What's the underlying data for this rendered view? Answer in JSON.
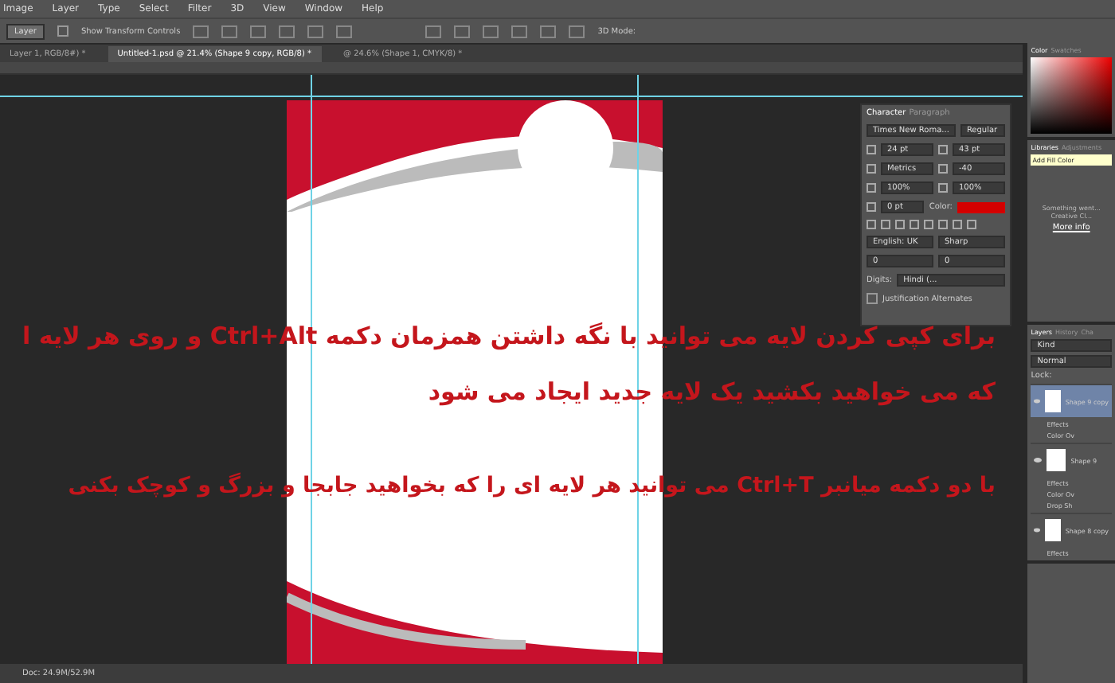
{
  "menu": [
    "Image",
    "Layer",
    "Type",
    "Select",
    "Filter",
    "3D",
    "View",
    "Window",
    "Help"
  ],
  "options_bar": {
    "select": "Layer",
    "show_transform_controls": {
      "label": "Show Transform Controls",
      "checked": false
    },
    "mode_label": "3D Mode:"
  },
  "tabs": [
    {
      "label": "Layer 1, RGB/8#) *",
      "selected": false
    },
    {
      "label": "Untitled-1.psd @ 21.4% (Shape 9 copy, RGB/8) *",
      "selected": true
    },
    {
      "label": "@ 24.6% (Shape 1, CMYK/8) *",
      "selected": false
    }
  ],
  "character_panel": {
    "tabs": [
      {
        "label": "Character",
        "selected": true
      },
      {
        "label": "Paragraph",
        "selected": false
      }
    ],
    "font": "Times New Roma...",
    "style": "Regular",
    "size": "24 pt",
    "leading": "43 pt",
    "kerning": "Metrics",
    "tracking": "-40",
    "vertical_scale": "100%",
    "horizontal_scale": "100%",
    "baseline": "0 pt",
    "color_label": "Color:",
    "color": "#d40000",
    "language": "English: UK",
    "antialias": "Sharp",
    "value_1": "0",
    "value_2": "0",
    "digits_label": "Digits:",
    "digits": "Hindi (...",
    "justification": {
      "label": "Justification Alternates",
      "checked": false
    }
  },
  "right_panel": {
    "color_tabs": [
      {
        "label": "Color",
        "selected": true
      },
      {
        "label": "Swatches",
        "selected": false
      }
    ],
    "library_tabs": [
      {
        "label": "Libraries",
        "selected": true
      },
      {
        "label": "Adjustments",
        "selected": false
      }
    ],
    "tooltip": "Add Fill Color",
    "message": "Something went... Creative Cl...",
    "link": "More info",
    "layer_tabs": [
      {
        "label": "Layers",
        "selected": true
      },
      {
        "label": "History",
        "selected": false
      },
      {
        "label": "Cha",
        "selected": false
      }
    ],
    "filter": "Kind",
    "blend": "Normal",
    "lock_label": "Lock:",
    "layers": [
      {
        "kind": "layer",
        "name": "Shape 9 copy",
        "selected": true
      },
      {
        "kind": "effect",
        "name": "Effects"
      },
      {
        "kind": "effect",
        "name": "Color Ov"
      },
      {
        "kind": "layer",
        "name": "Shape 9",
        "selected": false
      },
      {
        "kind": "effect",
        "name": "Effects"
      },
      {
        "kind": "effect",
        "name": "Color Ov"
      },
      {
        "kind": "effect",
        "name": "Drop Sh"
      },
      {
        "kind": "layer",
        "name": "Shape 8 copy",
        "selected": false
      },
      {
        "kind": "effect",
        "name": "Effects"
      }
    ]
  },
  "overlay_text": [
    "برای کپی کردن لایه می توانید با نگه داشتن همزمان دکمه Ctrl+Alt و روی هر لایه ا",
    "که می خواهید بکشید یک لایه جدید ایجاد می شود",
    "با دو دکمه میانبر Ctrl+T می توانید هر لایه ای را که بخواهید جابجا و بزرگ و کوچک بکنی"
  ],
  "status_bar": "Doc: 24.9M/52.9M"
}
